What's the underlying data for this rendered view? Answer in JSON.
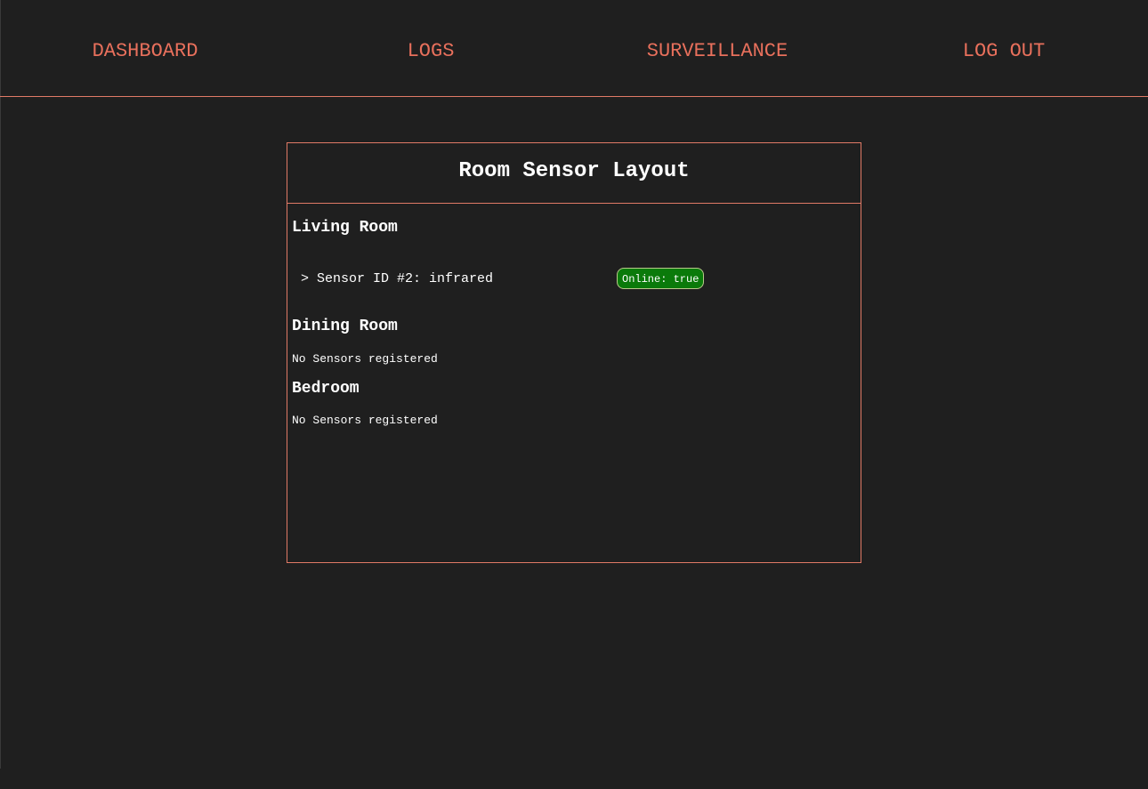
{
  "nav": {
    "items": [
      {
        "label": "DASHBOARD"
      },
      {
        "label": "LOGS"
      },
      {
        "label": "SURVEILLANCE"
      },
      {
        "label": "LOG OUT"
      }
    ]
  },
  "panel": {
    "title": "Room Sensor Layout",
    "rooms": [
      {
        "name": "Living Room",
        "sensors": [
          {
            "label": "> Sensor ID #2: infrared",
            "status": "Online: true"
          }
        ]
      },
      {
        "name": "Dining Room",
        "empty_text": "No Sensors registered"
      },
      {
        "name": "Bedroom",
        "empty_text": "No Sensors registered"
      }
    ]
  },
  "colors": {
    "background": "#1f1f1f",
    "accent": "#e8705c",
    "border": "#e07a66",
    "status_online": "#0a7a0a"
  }
}
